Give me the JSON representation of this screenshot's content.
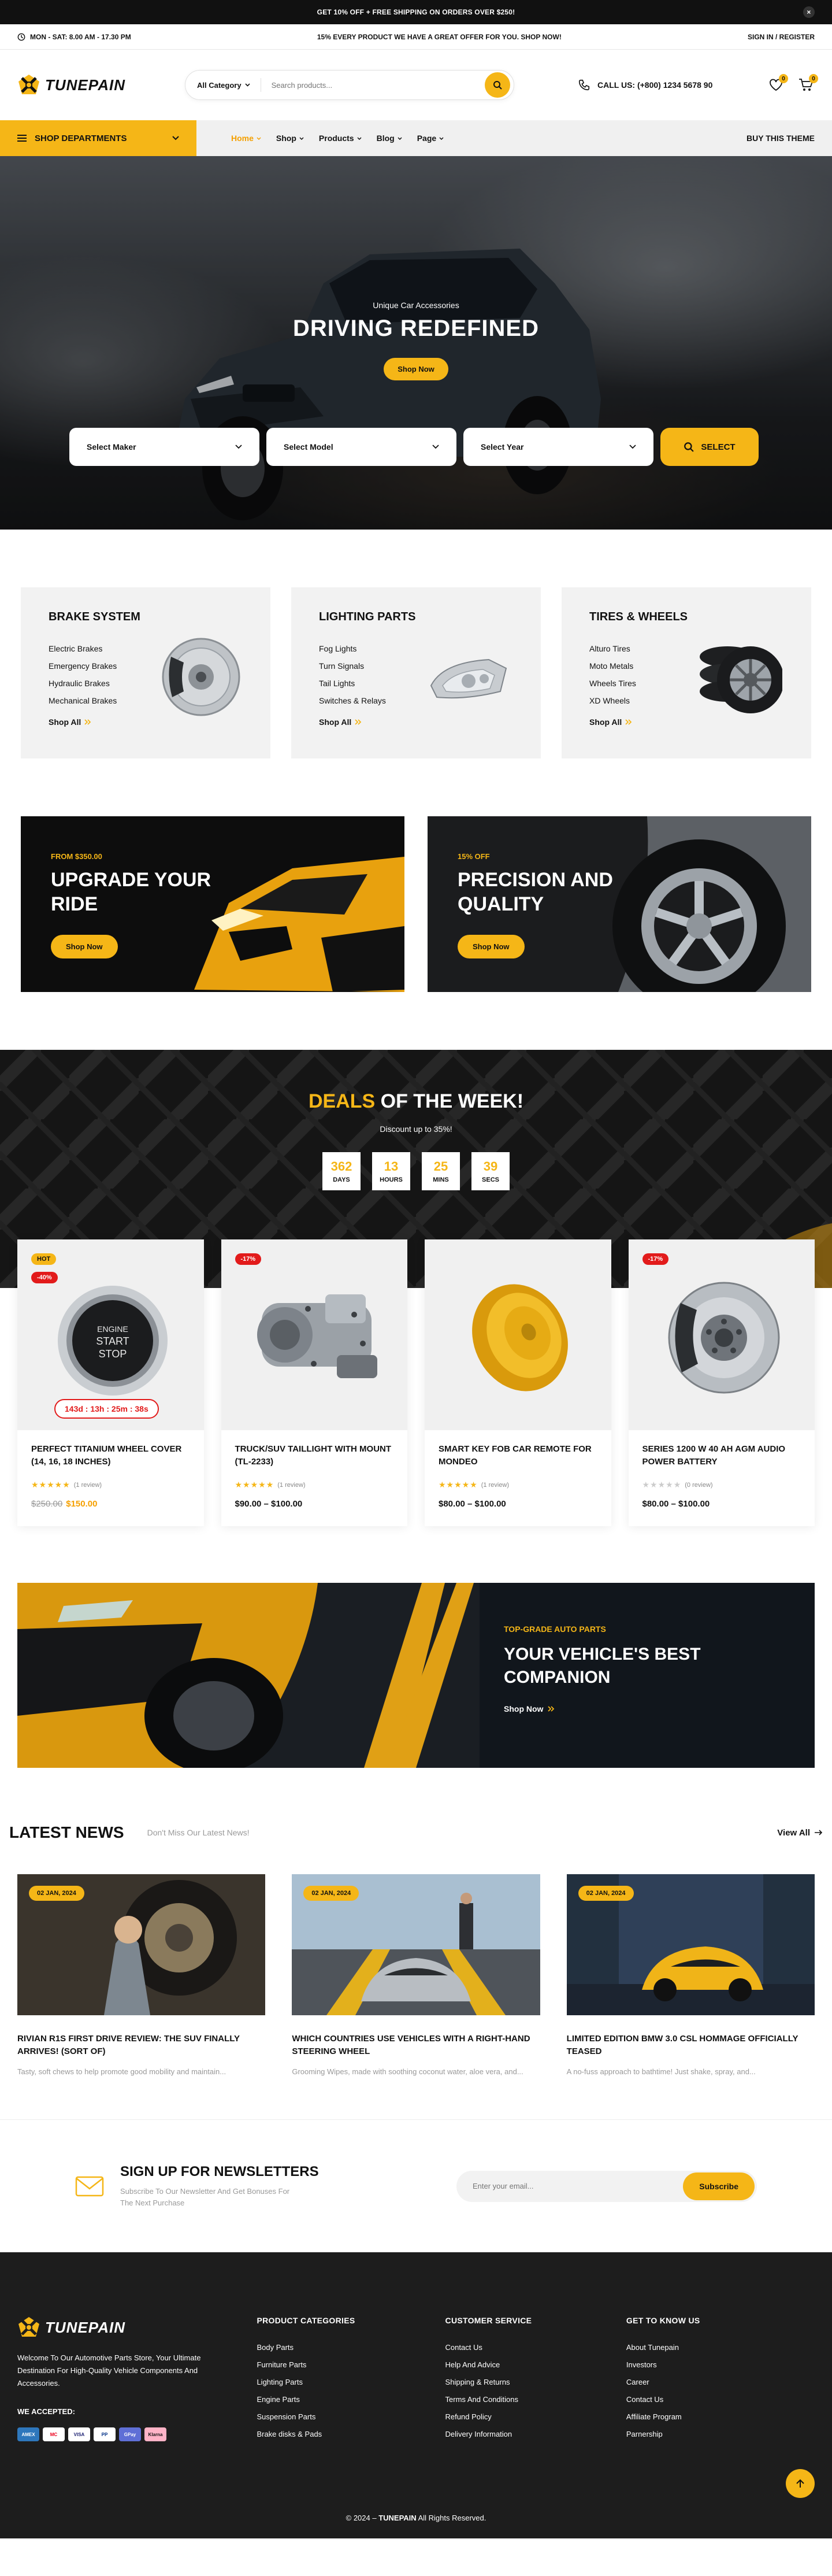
{
  "topbar": {
    "promo": "GET 10% OFF + FREE SHIPPING ON ORDERS OVER $250!",
    "close": "×"
  },
  "infobar": {
    "hours": "MON - SAT: 8.00 AM - 17.30 PM",
    "offer": "15% EVERY PRODUCT WE HAVE A GREAT OFFER FOR YOU. SHOP NOW!",
    "account": "SIGN IN / REGISTER"
  },
  "header": {
    "brand": "TUNEPAIN",
    "search_category": "All Category",
    "search_placeholder": "Search products...",
    "call": "CALL US: (+800) 1234 5678 90",
    "wishlist_count": "0",
    "cart_count": "0"
  },
  "nav": {
    "departments": "SHOP DEPARTMENTS",
    "items": [
      "Home",
      "Shop",
      "Products",
      "Blog",
      "Page"
    ],
    "buy": "BUY THIS THEME"
  },
  "hero": {
    "subtitle": "Unique Car Accessories",
    "title": "DRIVING REDEFINED",
    "button": "Shop Now",
    "selects": [
      "Select Maker",
      "Select Model",
      "Select Year"
    ],
    "select_button": "SELECT"
  },
  "categories": [
    {
      "title": "BRAKE SYSTEM",
      "items": [
        "Electric Brakes",
        "Emergency Brakes",
        "Hydraulic Brakes",
        "Mechanical Brakes"
      ],
      "link": "Shop All"
    },
    {
      "title": "LIGHTING PARTS",
      "items": [
        "Fog Lights",
        "Turn Signals",
        "Tail Lights",
        "Switches & Relays"
      ],
      "link": "Shop All"
    },
    {
      "title": "TIRES & WHEELS",
      "items": [
        "Alturo Tires",
        "Moto Metals",
        "Wheels Tires",
        "XD Wheels"
      ],
      "link": "Shop All"
    }
  ],
  "promos": [
    {
      "tag": "FROM $350.00",
      "title": "UPGRADE YOUR RIDE",
      "button": "Shop Now"
    },
    {
      "tag": "15% OFF",
      "title": "PRECISION AND QUALITY",
      "button": "Shop Now"
    }
  ],
  "deals": {
    "title_accent": "DEALS",
    "title_rest": " OF THE WEEK!",
    "subtitle": "Discount up to 35%!",
    "countdown": [
      {
        "value": "362",
        "label": "DAYS"
      },
      {
        "value": "13",
        "label": "HOURS"
      },
      {
        "value": "25",
        "label": "MINS"
      },
      {
        "value": "39",
        "label": "SECS"
      }
    ]
  },
  "products": [
    {
      "badges": [
        "HOT",
        "-40%"
      ],
      "timer": "143d : 13h : 25m : 38s",
      "name": "PERFECT TITANIUM WHEEL COVER (14, 16, 18 INCHES)",
      "rating": 5,
      "reviews": "(1 review)",
      "old_price": "$250.00",
      "price": "$150.00",
      "image_text": [
        "ENGINE",
        "START",
        "STOP"
      ]
    },
    {
      "badges": [
        "-17%"
      ],
      "name": "TRUCK/SUV TAILLIGHT WITH MOUNT (TL-2233)",
      "rating": 5,
      "reviews": "(1 review)",
      "price": "$90.00 – $100.00"
    },
    {
      "badges": [],
      "name": "SMART KEY FOB CAR REMOTE FOR MONDEO",
      "rating": 5,
      "reviews": "(1 review)",
      "price": "$80.00 – $100.00"
    },
    {
      "badges": [
        "-17%"
      ],
      "name": "SERIES 1200 W 40 AH AGM AUDIO POWER BATTERY",
      "rating": 0,
      "reviews": "(0 review)",
      "price": "$80.00 – $100.00"
    }
  ],
  "banner": {
    "tag": "TOP-GRADE AUTO PARTS",
    "title_line1": "YOUR VEHICLE'S BEST",
    "title_line2": "COMPANION",
    "link": "Shop Now"
  },
  "news": {
    "title": "LATEST NEWS",
    "subtitle": "Don't Miss Our Latest News!",
    "view_all": "View All",
    "posts": [
      {
        "date": "02 JAN, 2024",
        "title": "RIVIAN R1S FIRST DRIVE REVIEW: THE SUV FINALLY ARRIVES! (SORT OF)",
        "excerpt": "Tasty, soft chews to help promote good mobility and maintain..."
      },
      {
        "date": "02 JAN, 2024",
        "title": "WHICH COUNTRIES USE VEHICLES WITH A RIGHT-HAND STEERING WHEEL",
        "excerpt": "Grooming Wipes, made with soothing coconut water, aloe vera, and..."
      },
      {
        "date": "02 JAN, 2024",
        "title": "LIMITED EDITION BMW 3.0 CSL HOMMAGE OFFICIALLY TEASED",
        "excerpt": "A no-fuss approach to bathtime! Just shake, spray, and..."
      }
    ]
  },
  "newsletter": {
    "title": "SIGN UP FOR NEWSLETTERS",
    "text": "Subscribe To Our Newsletter And Get Bonuses For The Next Purchase",
    "placeholder": "Enter your email...",
    "button": "Subscribe"
  },
  "footer": {
    "description": "Welcome To Our Automotive Parts Store, Your Ultimate Destination For High-Quality Vehicle Components And Accessories.",
    "accepted": "WE ACCEPTED:",
    "payments": [
      "AMEX",
      "MC",
      "VISA",
      "PP",
      "GPay",
      "Klarna"
    ],
    "columns": [
      {
        "title": "PRODUCT CATEGORIES",
        "items": [
          "Body Parts",
          "Furniture Parts",
          "Lighting Parts",
          "Engine Parts",
          "Suspension Parts",
          "Brake disks & Pads"
        ]
      },
      {
        "title": "CUSTOMER SERVICE",
        "items": [
          "Contact Us",
          "Help And Advice",
          "Shipping & Returns",
          "Terms And Conditions",
          "Refund Policy",
          "Delivery Information"
        ]
      },
      {
        "title": "GET TO KNOW US",
        "items": [
          "About Tunepain",
          "Investors",
          "Career",
          "Contact Us",
          "Affiliate Program",
          "Parnership"
        ]
      }
    ],
    "copyright_pre": "© 2024 – ",
    "copyright_brand": "TUNEPAIN",
    "copyright_post": " All Rights Reserved."
  }
}
